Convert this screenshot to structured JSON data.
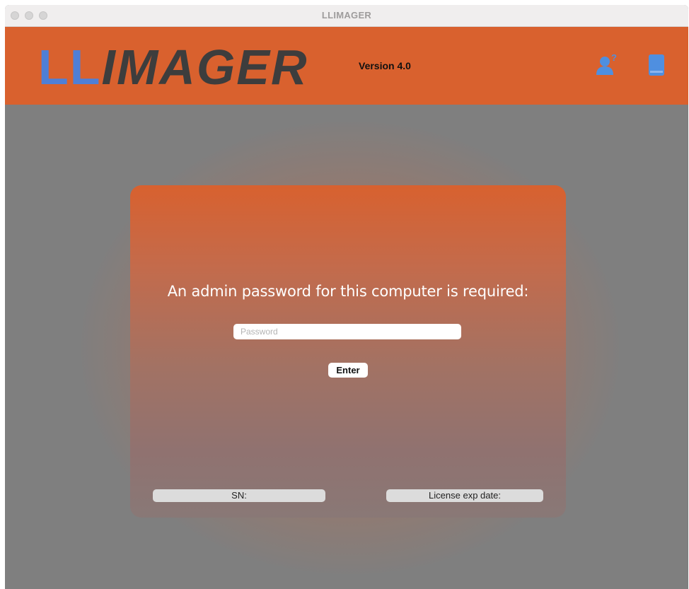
{
  "window": {
    "title": "LLIMAGER"
  },
  "header": {
    "logo_ll": "LL",
    "logo_rest": "IMAGER",
    "version": "Version 4.0",
    "icons": {
      "help": "user-help-icon",
      "manual": "book-icon"
    },
    "colors": {
      "brand_orange": "#d9612e",
      "logo_blue": "#4f7fd6",
      "logo_dark": "#3d3d3d",
      "icon_blue": "#4f8fe0"
    }
  },
  "login": {
    "prompt": "An admin password for this computer is required:",
    "password_placeholder": "Password",
    "password_value": "",
    "enter_label": "Enter"
  },
  "footer_fields": {
    "sn_label": "SN:",
    "license_label": "License exp date:"
  }
}
